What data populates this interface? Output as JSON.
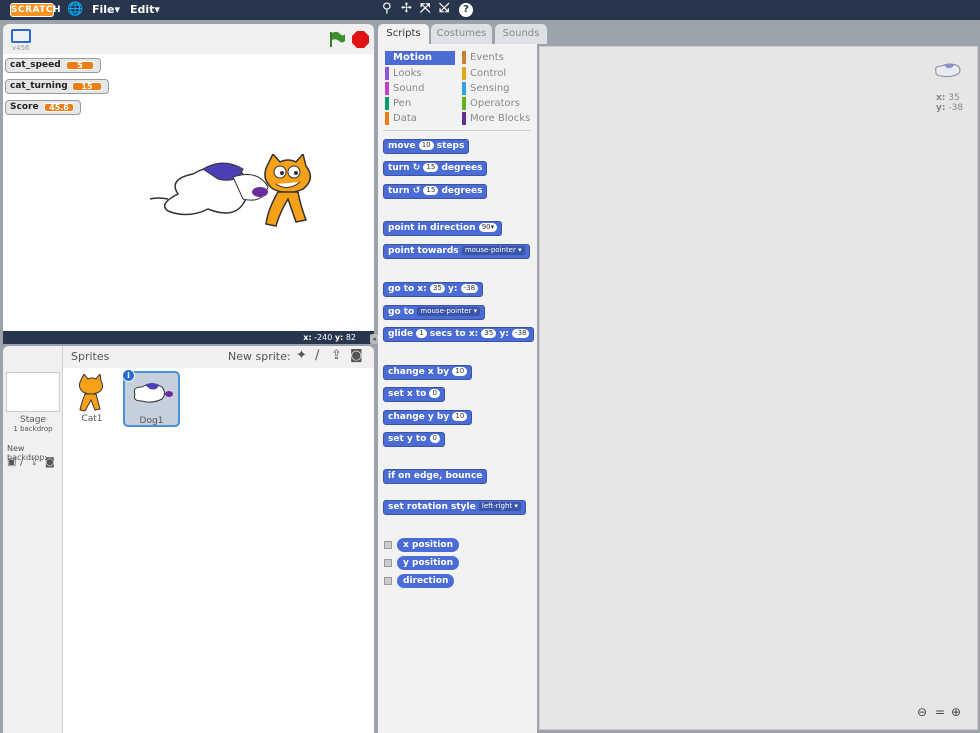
{
  "topbar": {
    "logo": "SCRATCH",
    "file": "File▾",
    "edit": "Edit▾"
  },
  "stage": {
    "version": "v456",
    "coords_label": "x:",
    "x": "-240",
    "y_label": "y:",
    "y": "82"
  },
  "monitors": [
    {
      "name": "cat_speed",
      "value": "5"
    },
    {
      "name": "cat_turning",
      "value": "15"
    },
    {
      "name": "Score",
      "value": "45.6"
    }
  ],
  "sprites_pane": {
    "title": "Sprites",
    "new_sprite": "New sprite:",
    "stage_label": "Stage",
    "backdrops": "1 backdrop",
    "new_backdrop": "New backdrop:",
    "sprites": [
      {
        "name": "Cat1"
      },
      {
        "name": "Dog1"
      }
    ]
  },
  "tabs": {
    "scripts": "Scripts",
    "costumes": "Costumes",
    "sounds": "Sounds"
  },
  "categories": {
    "motion": "Motion",
    "looks": "Looks",
    "sound": "Sound",
    "pen": "Pen",
    "data": "Data",
    "events": "Events",
    "control": "Control",
    "sensing": "Sensing",
    "operators": "Operators",
    "more": "More Blocks"
  },
  "blocks": {
    "move": {
      "a": "move",
      "v": "10",
      "b": "steps"
    },
    "turn_r": {
      "a": "turn",
      "v": "15",
      "b": "degrees"
    },
    "turn_l": {
      "a": "turn",
      "v": "15",
      "b": "degrees"
    },
    "point_dir": {
      "a": "point in direction",
      "v": "90▾"
    },
    "point_towards": {
      "a": "point towards",
      "v": "mouse-pointer ▾"
    },
    "goto_xy": {
      "a": "go to x:",
      "x": "35",
      "b": "y:",
      "y": "-38"
    },
    "goto": {
      "a": "go to",
      "v": "mouse-pointer ▾"
    },
    "glide": {
      "a": "glide",
      "v": "1",
      "b": "secs to x:",
      "x": "35",
      "c": "y:",
      "y": "-38"
    },
    "change_x": {
      "a": "change x by",
      "v": "10"
    },
    "set_x": {
      "a": "set x to",
      "v": "0"
    },
    "change_y": {
      "a": "change y by",
      "v": "10"
    },
    "set_y": {
      "a": "set y to",
      "v": "0"
    },
    "bounce": {
      "a": "if on edge, bounce"
    },
    "rotation": {
      "a": "set rotation style",
      "v": "left-right ▾"
    },
    "xpos": "x position",
    "ypos": "y position",
    "direction": "direction"
  },
  "sprite_info": {
    "x_label": "x:",
    "x": "35",
    "y_label": "y:",
    "y": "-38"
  },
  "colors": {
    "topbar": "#28364d",
    "motion": "#4a6cd4",
    "looks": "#8a55d7",
    "sound": "#bb42c3",
    "pen": "#0e9a6c",
    "data": "#ee7d16",
    "events": "#c88330",
    "control": "#e1a91a",
    "sensing": "#2ca5e2",
    "operators": "#5cb712",
    "more": "#632d99"
  }
}
